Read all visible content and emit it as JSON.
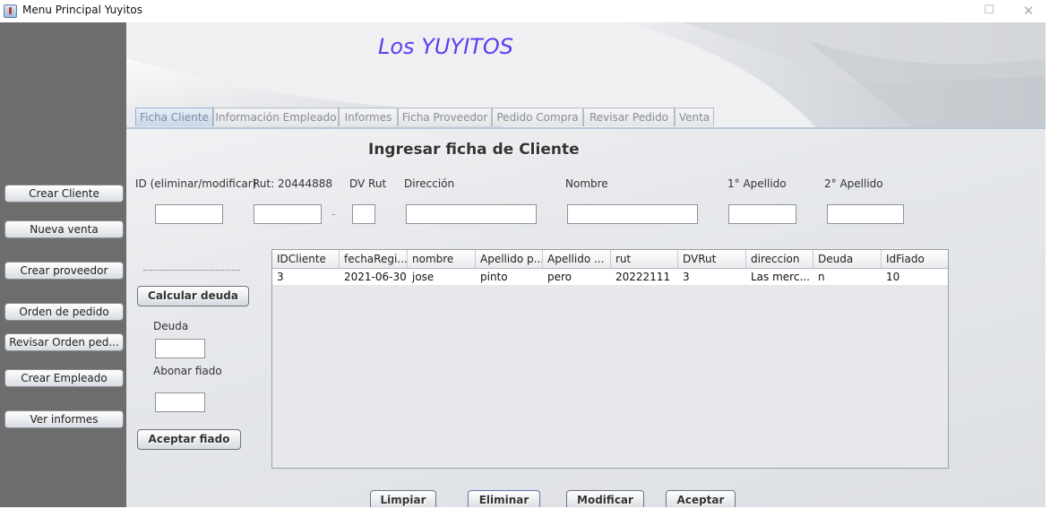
{
  "window": {
    "title": "Menu Principal Yuyitos",
    "maximize_glyph": "☐",
    "close_glyph": "✕"
  },
  "sidebar": {
    "items": [
      {
        "label": "Crear Cliente"
      },
      {
        "label": "Nueva venta"
      },
      {
        "label": "Crear proveedor"
      },
      {
        "label": "Orden de pedido"
      },
      {
        "label": "Revisar Orden ped..."
      },
      {
        "label": "Crear Empleado"
      },
      {
        "label": "Ver informes"
      }
    ]
  },
  "header": {
    "brand": "Los YUYITOS"
  },
  "tabs": [
    {
      "label": "Ficha Cliente",
      "active": true
    },
    {
      "label": "Información Empleado"
    },
    {
      "label": "Informes"
    },
    {
      "label": "Ficha Proveedor"
    },
    {
      "label": "Pedido Compra"
    },
    {
      "label": "Revisar Pedido"
    },
    {
      "label": "Venta"
    }
  ],
  "form": {
    "title": "Ingresar ficha de Cliente",
    "labels": {
      "id": "ID (eliminar/modificar)",
      "rut": "Rut: 20444888",
      "dv": "DV Rut",
      "direccion": "Dirección",
      "nombre": "Nombre",
      "apellido1": "1° Apellido",
      "apellido2": "2° Apellido",
      "deuda": "Deuda",
      "abonar": "Abonar fiado"
    },
    "values": {
      "id": "",
      "rut": "",
      "dv": "",
      "direccion": "",
      "nombre": "",
      "apellido1": "",
      "apellido2": "",
      "deuda": "",
      "abonar": ""
    },
    "dash": "-",
    "buttons": {
      "calcular": "Calcular deuda",
      "aceptar_fiado": "Aceptar fiado",
      "limpiar": "Limpiar",
      "eliminar": "Eliminar",
      "modificar": "Modificar",
      "aceptar": "Aceptar"
    }
  },
  "table": {
    "columns": [
      "IDCliente",
      "fechaRegi...",
      "nombre",
      "Apellido p...",
      "Apellido ...",
      "rut",
      "DVRut",
      "direccion",
      "Deuda",
      "IdFiado"
    ],
    "rows": [
      [
        "3",
        "2021-06-30",
        "jose",
        "pinto",
        "pero",
        "20222111",
        "3",
        "Las merc...",
        "n",
        "10"
      ]
    ]
  }
}
